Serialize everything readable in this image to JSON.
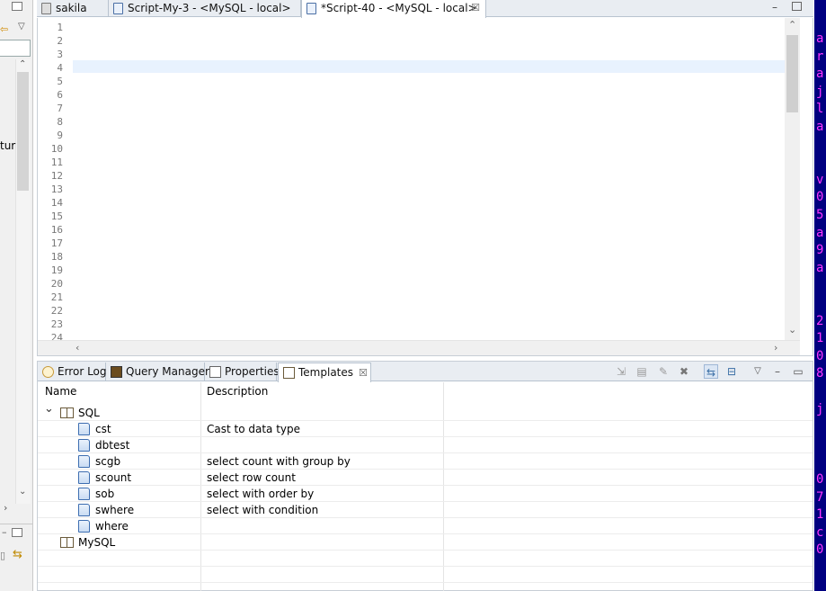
{
  "editor_tabs": [
    {
      "label": "sakila"
    },
    {
      "label": "Script-My-3 - <MySQL - local>"
    },
    {
      "label": "*Script-40 - <MySQL - local>",
      "active": true
    }
  ],
  "editor": {
    "line_numbers": [
      "1",
      "2",
      "3",
      "4",
      "5",
      "6",
      "7",
      "8",
      "9",
      "10",
      "11",
      "12",
      "13",
      "14",
      "15",
      "16",
      "17",
      "18",
      "19",
      "20",
      "21",
      "22",
      "23",
      "24"
    ],
    "current_line": 4,
    "content": ""
  },
  "left_pane": {
    "partial_text": "tur"
  },
  "view_tabs": [
    {
      "label": "Error Log",
      "icon": "error-log-icon"
    },
    {
      "label": "Query Manager",
      "icon": "query-manager-icon"
    },
    {
      "label": "Properties",
      "icon": "properties-icon"
    },
    {
      "label": "Templates",
      "icon": "templates-icon",
      "active": true
    }
  ],
  "templates_table": {
    "columns": [
      "Name",
      "Description"
    ],
    "groups": [
      {
        "name": "SQL",
        "expanded": true,
        "items": [
          {
            "name": "cst",
            "description": "Cast to data type"
          },
          {
            "name": "dbtest",
            "description": ""
          },
          {
            "name": "scgb",
            "description": "select count with group by"
          },
          {
            "name": "scount",
            "description": "select row count"
          },
          {
            "name": "sob",
            "description": "select with order by"
          },
          {
            "name": "swhere",
            "description": "select with condition"
          },
          {
            "name": "where",
            "description": ""
          }
        ]
      },
      {
        "name": "MySQL",
        "expanded": false,
        "items": []
      }
    ]
  },
  "right_strip_chars": [
    "a",
    "r",
    "a",
    "j",
    "l",
    "a",
    "",
    "",
    "v",
    "0",
    "5",
    "a",
    "9",
    "a",
    "",
    "",
    "2",
    "1",
    "0",
    "8",
    "",
    "j",
    "",
    "",
    "",
    "0",
    "7",
    "1",
    "c",
    "0"
  ],
  "colors": {
    "current_line": "#e8f2fe",
    "tab_bar": "#e9edf2",
    "right_strip_bg": "#000080",
    "right_strip_text": "#ff33ff"
  }
}
